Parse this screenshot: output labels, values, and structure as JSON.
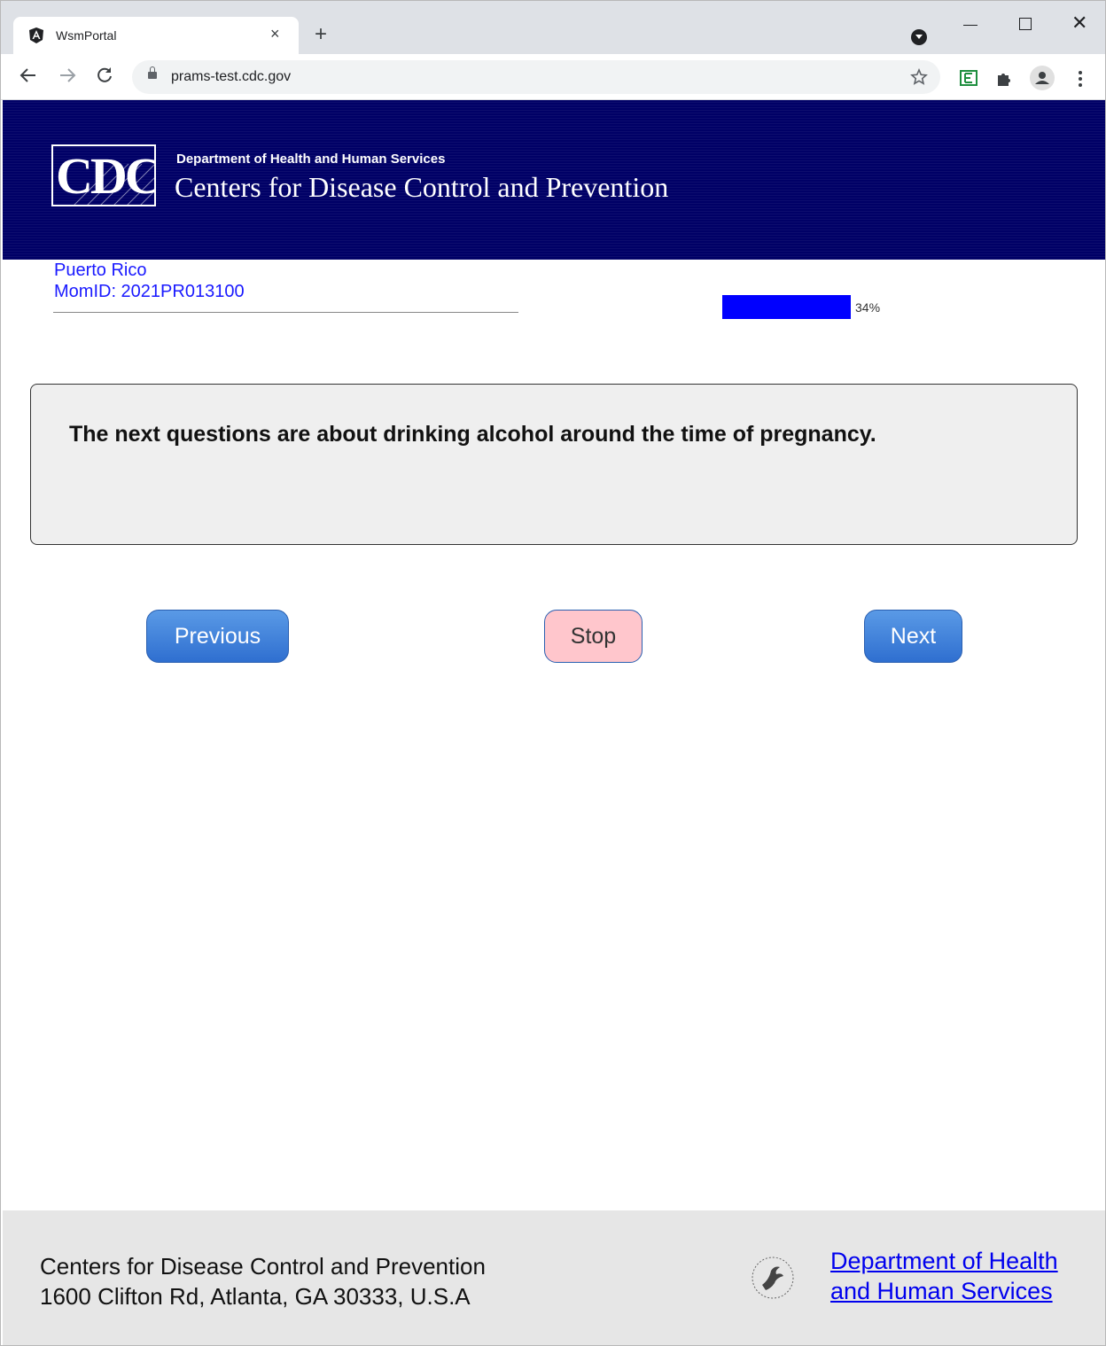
{
  "browser": {
    "tab_title": "WsmPortal",
    "tab_close": "×",
    "new_tab": "+",
    "url": "prams-test.cdc.gov",
    "window_close": "✕"
  },
  "header": {
    "logo_text": "CDC",
    "dept_line": "Department of Health and Human Services",
    "cdc_line": "Centers for Disease Control and Prevention"
  },
  "site": {
    "location": "Puerto Rico",
    "mom_id": "MomID: 2021PR013100"
  },
  "progress": {
    "percent": 34,
    "label": "34%"
  },
  "question": {
    "text": "The next questions are about drinking alcohol around the time of pregnancy."
  },
  "buttons": {
    "previous": "Previous",
    "stop": "Stop",
    "next": "Next"
  },
  "footer": {
    "org_name": "Centers for Disease Control and Prevention",
    "address": "1600 Clifton Rd, Atlanta, GA 30333, U.S.A",
    "hhs_link_line1": "Department of Health",
    "hhs_link_line2": "and Human Services"
  },
  "colors": {
    "header_bg": "#000066",
    "progress_fill": "#0000ff",
    "site_text": "#1a1aff",
    "stop_bg": "#ffc6cc",
    "button_blue": "#3b7ddb"
  }
}
